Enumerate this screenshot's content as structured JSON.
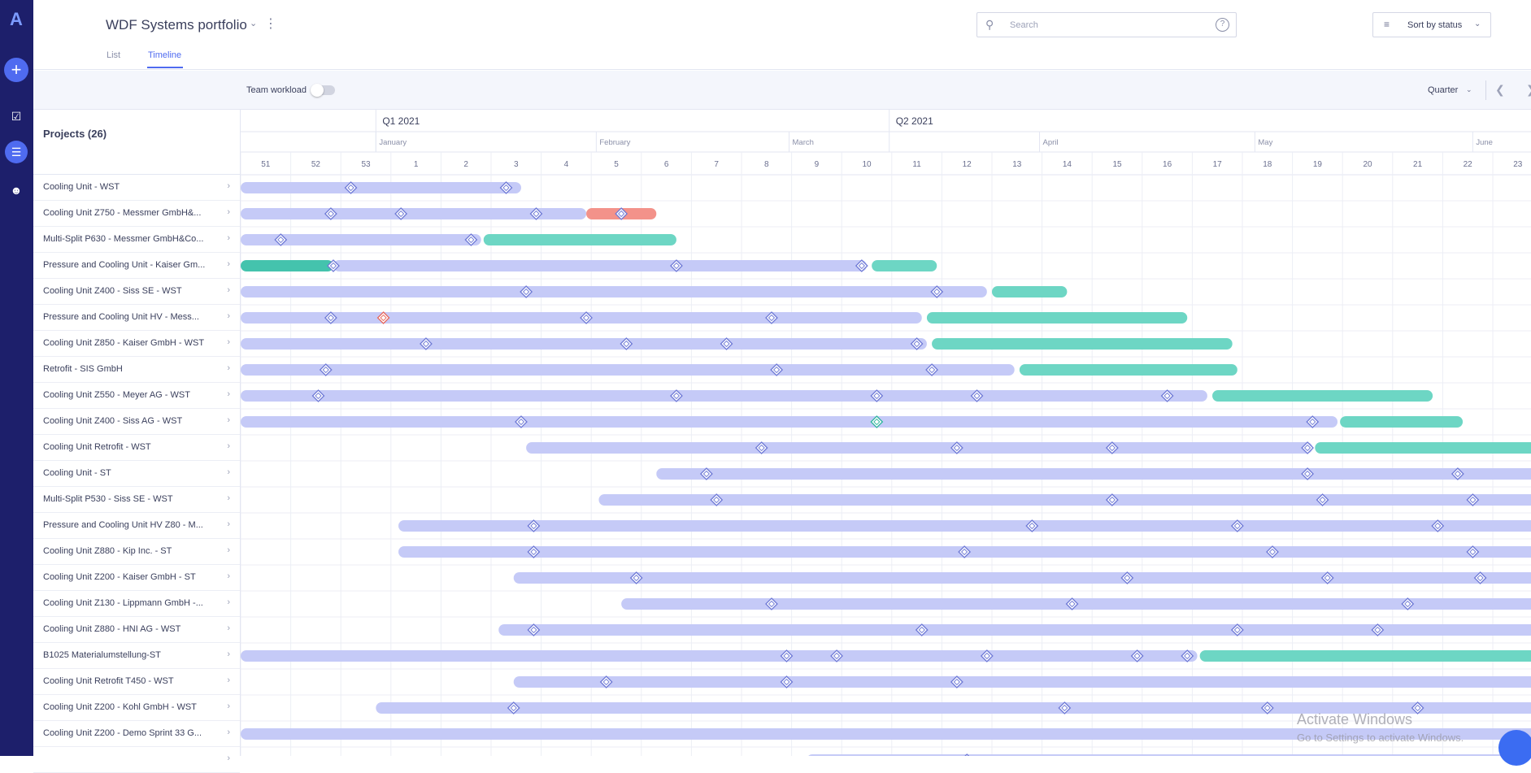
{
  "app": {
    "logo": "A",
    "accent": "#4f6bf0",
    "rail_color": "#1d1f6b"
  },
  "rail": [
    {
      "icon": "calendar-check-icon"
    },
    {
      "icon": "timeline-icon",
      "active": true
    },
    {
      "icon": "team-icon"
    }
  ],
  "header": {
    "title": "WDF Systems portfolio",
    "tabs": [
      {
        "label": "List",
        "active": false
      },
      {
        "label": "Timeline",
        "active": true
      }
    ],
    "search": {
      "placeholder": "Search"
    },
    "sort_label": "Sort by status"
  },
  "toolbar": {
    "team_workload_label": "Team workload",
    "team_workload_on": false,
    "period_label": "Quarter"
  },
  "projects_title": "Projects (26)",
  "timeline": {
    "quarters": [
      "Q1 2021",
      "Q2 2021"
    ],
    "months": [
      "January",
      "February",
      "March",
      "April",
      "May",
      "June"
    ],
    "weeks": [
      "51",
      "52",
      "53",
      "1",
      "2",
      "3",
      "4",
      "5",
      "6",
      "7",
      "8",
      "9",
      "10",
      "11",
      "12",
      "13",
      "14",
      "15",
      "16",
      "17",
      "18",
      "19",
      "20",
      "21",
      "22",
      "23"
    ],
    "colors": {
      "planned": "#c5caf7",
      "done": "#6dd6c4",
      "done_dark": "#44c3ad",
      "overdue": "#f3928a"
    }
  },
  "rows": [
    {
      "name": "Cooling Unit - WST",
      "bars": [
        [
          0,
          5.6,
          "planned"
        ]
      ],
      "ms": [
        2.2,
        5.3
      ]
    },
    {
      "name": "Cooling Unit Z750 - Messmer GmbH&...",
      "bars": [
        [
          0,
          6.9,
          "planned"
        ],
        [
          6.9,
          8.3,
          "overdue"
        ]
      ],
      "ms": [
        1.8,
        3.2,
        5.9,
        7.6
      ]
    },
    {
      "name": "Multi-Split P630 - Messmer GmbH&Co...",
      "bars": [
        [
          0,
          4.8,
          "planned"
        ],
        [
          4.85,
          8.7,
          "done"
        ]
      ],
      "ms": [
        0.8,
        4.6
      ]
    },
    {
      "name": "Pressure and Cooling Unit - Kaiser Gm...",
      "bars": [
        [
          0,
          1.85,
          "done_dark"
        ],
        [
          1.85,
          12.5,
          "planned"
        ],
        [
          12.6,
          13.9,
          "done"
        ]
      ],
      "ms": [
        1.85,
        8.7,
        12.4
      ]
    },
    {
      "name": "Cooling Unit Z400 - Siss SE - WST",
      "bars": [
        [
          0,
          14.9,
          "planned"
        ],
        [
          15.0,
          16.5,
          "done"
        ]
      ],
      "ms": [
        5.7,
        13.9
      ]
    },
    {
      "name": "Pressure and Cooling Unit HV - Mess...",
      "bars": [
        [
          0,
          13.6,
          "planned"
        ],
        [
          13.7,
          18.9,
          "done"
        ]
      ],
      "ms": [
        1.8,
        6.9,
        10.6
      ],
      "ms_red": [
        2.85
      ]
    },
    {
      "name": "Cooling Unit Z850 - Kaiser GmbH - WST",
      "bars": [
        [
          0,
          13.7,
          "planned"
        ],
        [
          13.8,
          19.8,
          "done"
        ]
      ],
      "ms": [
        3.7,
        7.7,
        9.7,
        13.5
      ]
    },
    {
      "name": "Retrofit - SIS GmbH",
      "bars": [
        [
          0,
          15.45,
          "planned"
        ],
        [
          15.55,
          19.9,
          "done"
        ]
      ],
      "ms": [
        1.7,
        10.7,
        13.8
      ]
    },
    {
      "name": "Cooling Unit Z550 - Meyer AG - WST",
      "bars": [
        [
          0,
          19.3,
          "planned"
        ],
        [
          19.4,
          23.8,
          "done"
        ]
      ],
      "ms": [
        1.55,
        8.7,
        12.7,
        14.7,
        18.5
      ]
    },
    {
      "name": "Cooling Unit Z400 - Siss AG - WST",
      "bars": [
        [
          0,
          21.9,
          "planned"
        ],
        [
          21.95,
          24.4,
          "done"
        ]
      ],
      "ms": [
        5.6,
        12.7,
        21.4
      ],
      "ms_green": [
        12.7
      ]
    },
    {
      "name": "Cooling Unit Retrofit - WST",
      "bars": [
        [
          5.7,
          21.4,
          "planned"
        ],
        [
          21.45,
          27,
          "done"
        ]
      ],
      "ms": [
        10.4,
        14.3,
        17.4,
        21.3
      ]
    },
    {
      "name": "Cooling Unit - ST",
      "bars": [
        [
          8.3,
          27,
          "planned"
        ]
      ],
      "ms": [
        9.3,
        21.3,
        24.3
      ]
    },
    {
      "name": "Multi-Split P530 - Siss SE - WST",
      "bars": [
        [
          7.15,
          27,
          "planned"
        ]
      ],
      "ms": [
        9.5,
        17.4,
        21.6,
        24.6
      ]
    },
    {
      "name": "Pressure and Cooling Unit HV Z80 - M...",
      "bars": [
        [
          3.15,
          27,
          "planned"
        ]
      ],
      "ms": [
        5.85,
        15.8,
        19.9,
        23.9
      ]
    },
    {
      "name": "Cooling Unit Z880 - Kip Inc. - ST",
      "bars": [
        [
          3.15,
          27,
          "planned"
        ]
      ],
      "ms": [
        5.85,
        14.45,
        20.6,
        24.6
      ]
    },
    {
      "name": "Cooling Unit Z200 - Kaiser GmbH - ST",
      "bars": [
        [
          5.45,
          27,
          "planned"
        ]
      ],
      "ms": [
        7.9,
        17.7,
        21.7,
        24.75
      ]
    },
    {
      "name": "Cooling Unit Z130 - Lippmann GmbH -...",
      "bars": [
        [
          7.6,
          27,
          "planned"
        ]
      ],
      "ms": [
        10.6,
        16.6,
        23.3
      ]
    },
    {
      "name": "Cooling Unit Z880 - HNI AG - WST",
      "bars": [
        [
          5.15,
          27,
          "planned"
        ]
      ],
      "ms": [
        5.85,
        13.6,
        19.9,
        22.7
      ]
    },
    {
      "name": "B1025 Materialumstellung-ST",
      "bars": [
        [
          0,
          19.1,
          "planned"
        ],
        [
          19.15,
          27,
          "done"
        ]
      ],
      "ms": [
        10.9,
        11.9,
        14.9,
        17.9,
        18.9
      ]
    },
    {
      "name": "Cooling Unit Retrofit T450 - WST",
      "bars": [
        [
          5.45,
          27,
          "planned"
        ]
      ],
      "ms": [
        7.3,
        10.9,
        14.3
      ]
    },
    {
      "name": "Cooling Unit Z200 - Kohl GmbH - WST",
      "bars": [
        [
          2.7,
          27,
          "planned"
        ]
      ],
      "ms": [
        5.45,
        16.45,
        20.5,
        23.5
      ]
    },
    {
      "name": "Cooling Unit Z200 - Demo Sprint 33 G...",
      "bars": [
        [
          0,
          27,
          "planned"
        ]
      ],
      "ms": []
    },
    {
      "name": "",
      "bars": [
        [
          11.3,
          27,
          "planned"
        ]
      ],
      "ms": [
        14.5
      ]
    }
  ],
  "watermark": {
    "line1": "Activate Windows",
    "line2": "Go to Settings to activate Windows."
  }
}
